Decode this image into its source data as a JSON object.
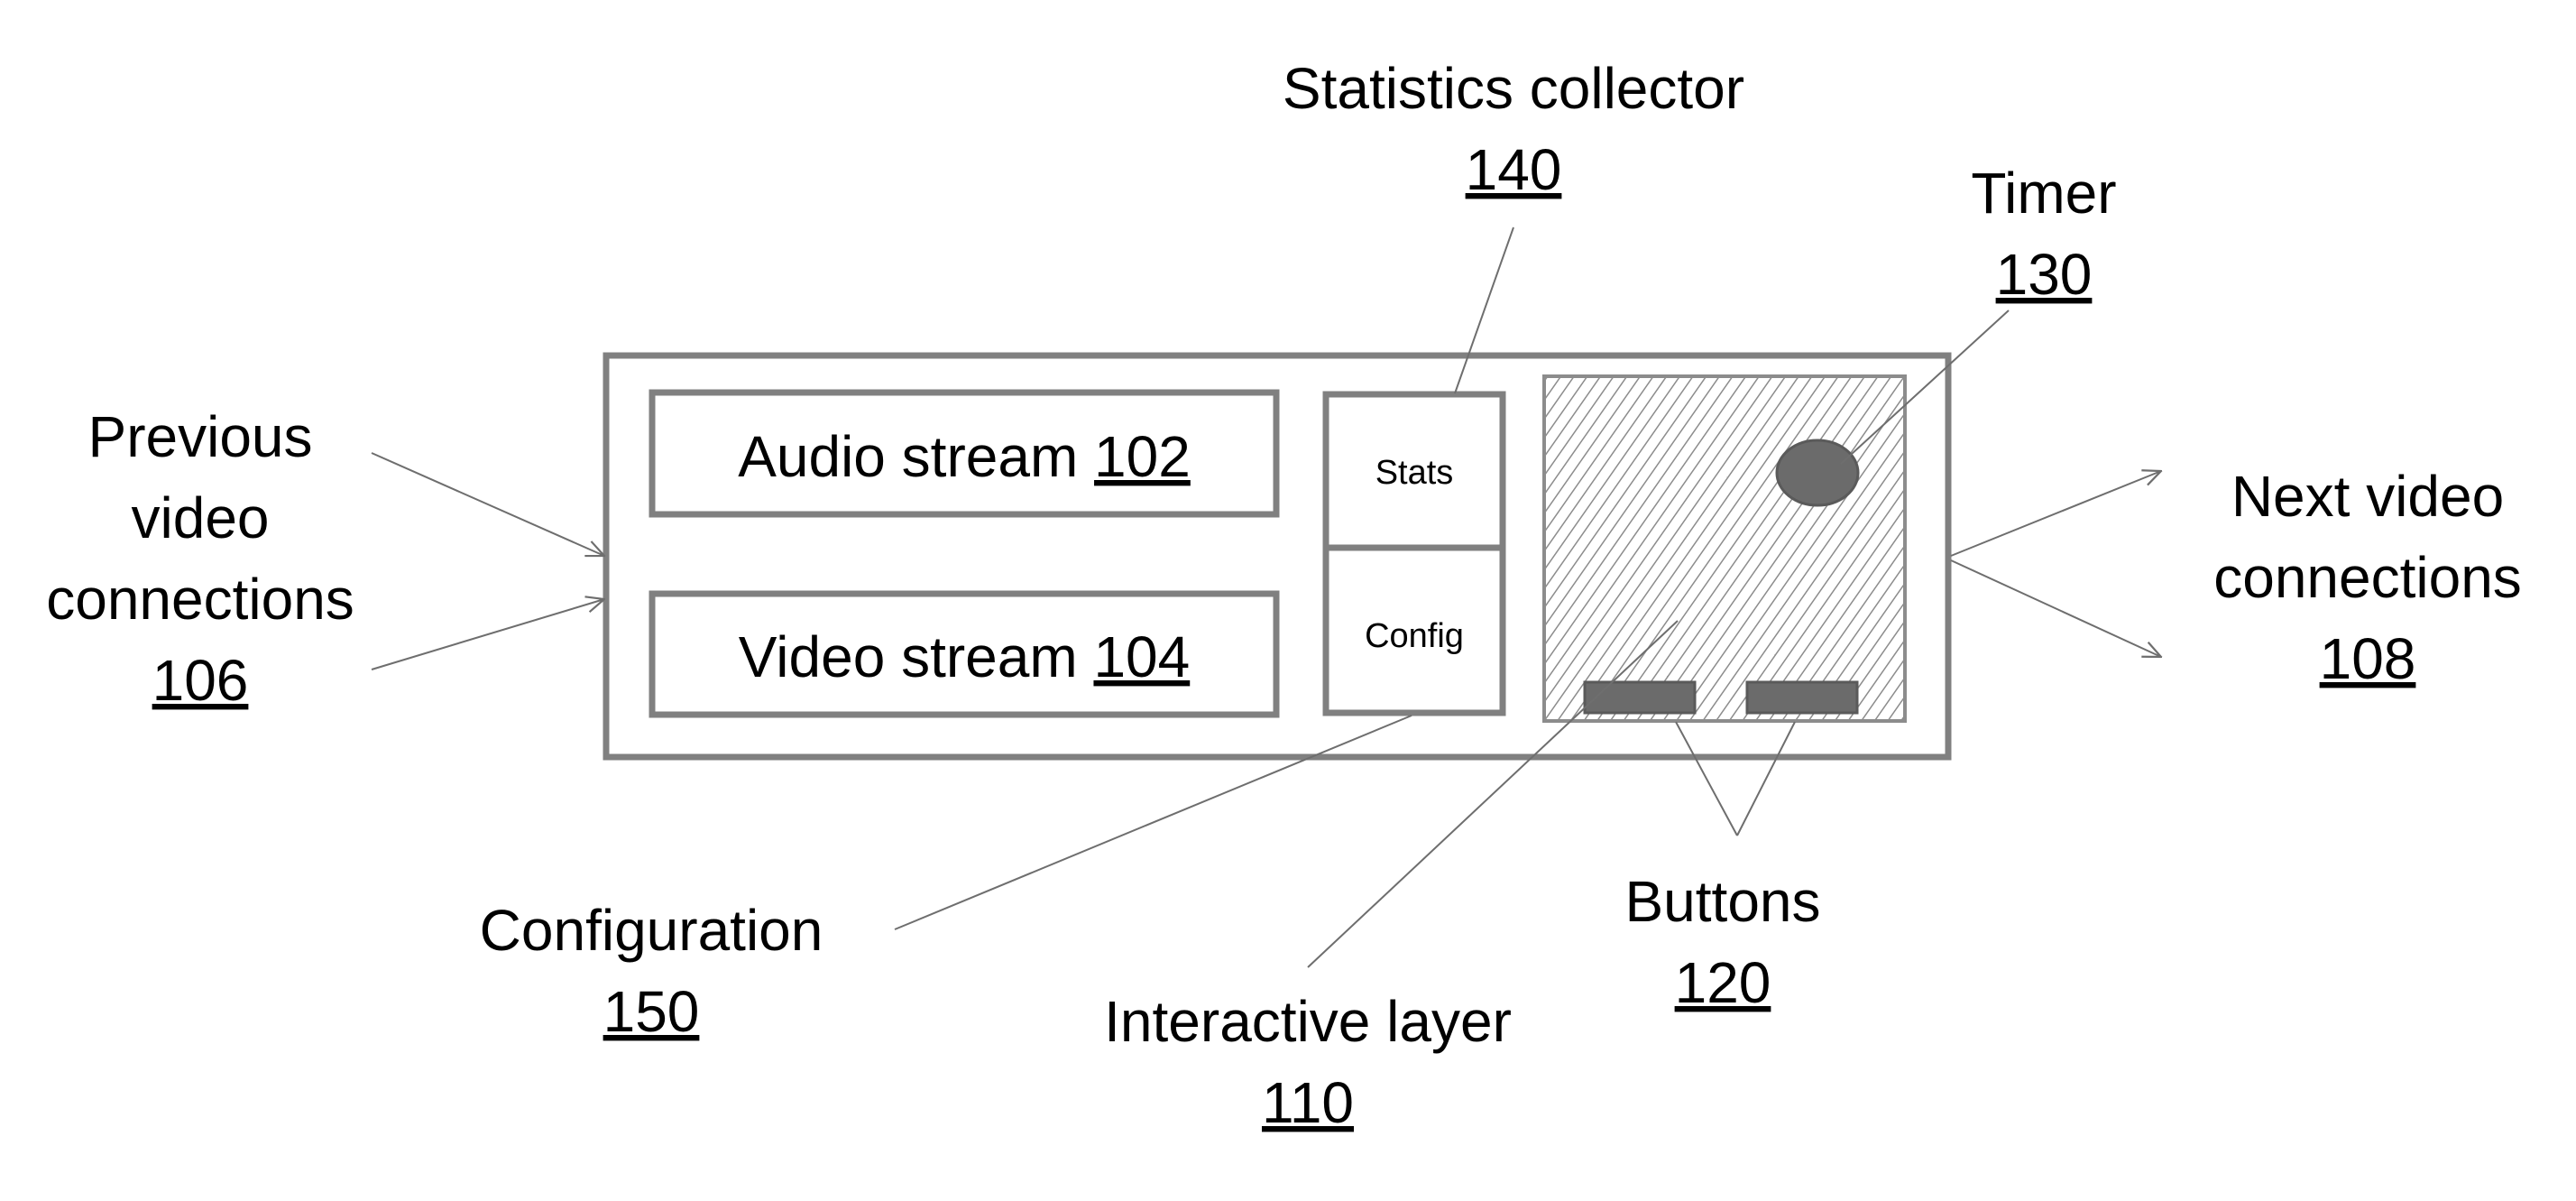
{
  "figure": {
    "components": {
      "audio_stream": {
        "label": "Audio stream",
        "ref": "102"
      },
      "video_stream": {
        "label": "Video stream",
        "ref": "104"
      },
      "stats_box": {
        "label": "Stats"
      },
      "config_box": {
        "label": "Config"
      }
    },
    "callouts": {
      "statistics_collector": {
        "lines": [
          "Statistics collector"
        ],
        "ref": "140"
      },
      "timer": {
        "lines": [
          "Timer"
        ],
        "ref": "130"
      },
      "previous_connections": {
        "lines": [
          "Previous",
          "video",
          "connections"
        ],
        "ref": "106"
      },
      "next_connections": {
        "lines": [
          "Next video",
          "connections"
        ],
        "ref": "108"
      },
      "configuration": {
        "lines": [
          "Configuration"
        ],
        "ref": "150"
      },
      "interactive_layer": {
        "lines": [
          "Interactive layer"
        ],
        "ref": "110"
      },
      "buttons": {
        "lines": [
          "Buttons"
        ],
        "ref": "120"
      }
    },
    "colors": {
      "stroke": "#808080",
      "line": "#6e6e6e",
      "hatch": "#9a9a9a",
      "timer_fill": "#6b6b6b",
      "button_fill": "#6b6b6b",
      "text": "#000000"
    }
  }
}
